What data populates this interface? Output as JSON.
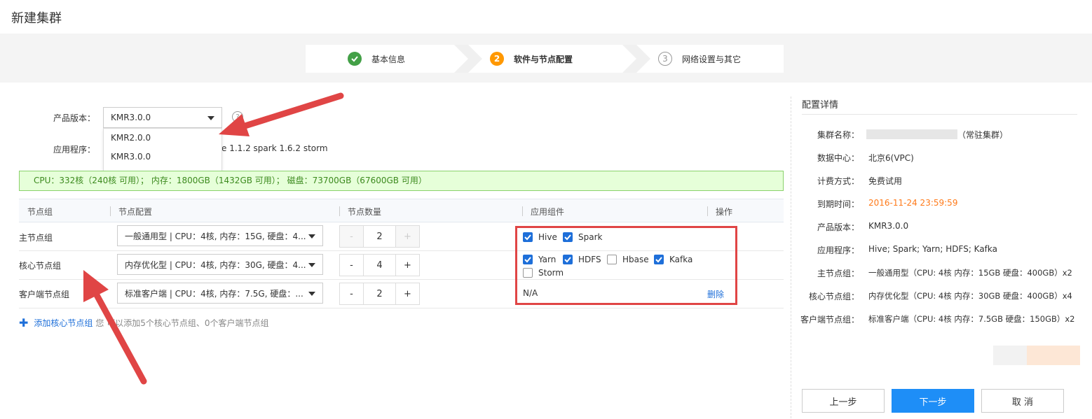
{
  "page_title": "新建集群",
  "steps": [
    {
      "index": "",
      "label": "基本信息",
      "state": "done"
    },
    {
      "index": "2",
      "label": "软件与节点配置",
      "state": "active"
    },
    {
      "index": "3",
      "label": "网络设置与其它",
      "state": "todo"
    }
  ],
  "form": {
    "product_version_label": "产品版本：",
    "product_version_value": "KMR3.0.0",
    "product_version_options": [
      "KMR2.0.0",
      "KMR3.0.0"
    ],
    "help_icon": "?",
    "apps_label": "应用程序：",
    "apps_value_visible": "e 1.1.2 spark 1.6.2 storm"
  },
  "resource_summary": "CPU：332核（240核 可用）； 内存：1800GB（1432GB 可用）； 磁盘：73700GB（67600GB 可用）",
  "table": {
    "headers": [
      "节点组",
      "节点配置",
      "节点数量",
      "应用组件",
      "操作"
    ],
    "rows": [
      {
        "group": "主节点组",
        "config": "一般通用型 | CPU：4核, 内存：15G, 硬盘：4...",
        "count": "2",
        "minus_disabled": true,
        "plus_disabled": true
      },
      {
        "group": "核心节点组",
        "config": "内存优化型 | CPU：4核, 内存：30G, 硬盘：4...",
        "count": "4",
        "minus_disabled": false,
        "plus_disabled": false
      },
      {
        "group": "客户端节点组",
        "config": "标准客户端 | CPU：4核, 内存：7.5G, 硬盘：...",
        "count": "2",
        "minus_disabled": false,
        "plus_disabled": false
      }
    ],
    "components": {
      "row1": [
        {
          "name": "Hive",
          "checked": true
        },
        {
          "name": "Spark",
          "checked": true
        }
      ],
      "row2": [
        {
          "name": "Yarn",
          "checked": true
        },
        {
          "name": "HDFS",
          "checked": true
        },
        {
          "name": "Hbase",
          "checked": false
        },
        {
          "name": "Kafka",
          "checked": true
        },
        {
          "name": "Storm",
          "checked": false
        }
      ],
      "row3_text": "N/A"
    },
    "delete_label": "删除",
    "minus": "-",
    "plus": "+"
  },
  "add_group": {
    "label": "添加核心节点组",
    "hint": "您还可以添加5个核心节点组、0个客户端节点组",
    "hint_visible": "您  可以添加5个核心节点组、0个客户端节点组"
  },
  "details": {
    "title": "配置详情",
    "items": [
      {
        "label": "集群名称：",
        "value": "（常驻集群）"
      },
      {
        "label": "数据中心：",
        "value": "北京6(VPC)"
      },
      {
        "label": "计费方式：",
        "value": "免费试用"
      },
      {
        "label": "到期时间：",
        "value": "2016-11-24 23:59:59"
      },
      {
        "label": "产品版本：",
        "value": "KMR3.0.0"
      },
      {
        "label": "应用程序：",
        "value": "Hive; Spark; Yarn; HDFS; Kafka"
      },
      {
        "label": "主节点组：",
        "value": "一般通用型（CPU: 4核 内存：15GB 硬盘：400GB）x2"
      },
      {
        "label": "核心节点组：",
        "value": "内存优化型（CPU: 4核 内存：30GB 硬盘：400GB）x4"
      },
      {
        "label": "客户端节点组：",
        "value": "标准客户端（CPU: 4核 内存：7.5GB 硬盘：150GB）x2"
      }
    ]
  },
  "buttons": {
    "prev": "上一步",
    "next": "下一步",
    "cancel": "取 消"
  },
  "colors": {
    "accent": "#1e8ef7",
    "active_step": "#ff9800",
    "done_step": "#43a047",
    "annotation": "#e04545",
    "expire": "#ff7a1a"
  }
}
